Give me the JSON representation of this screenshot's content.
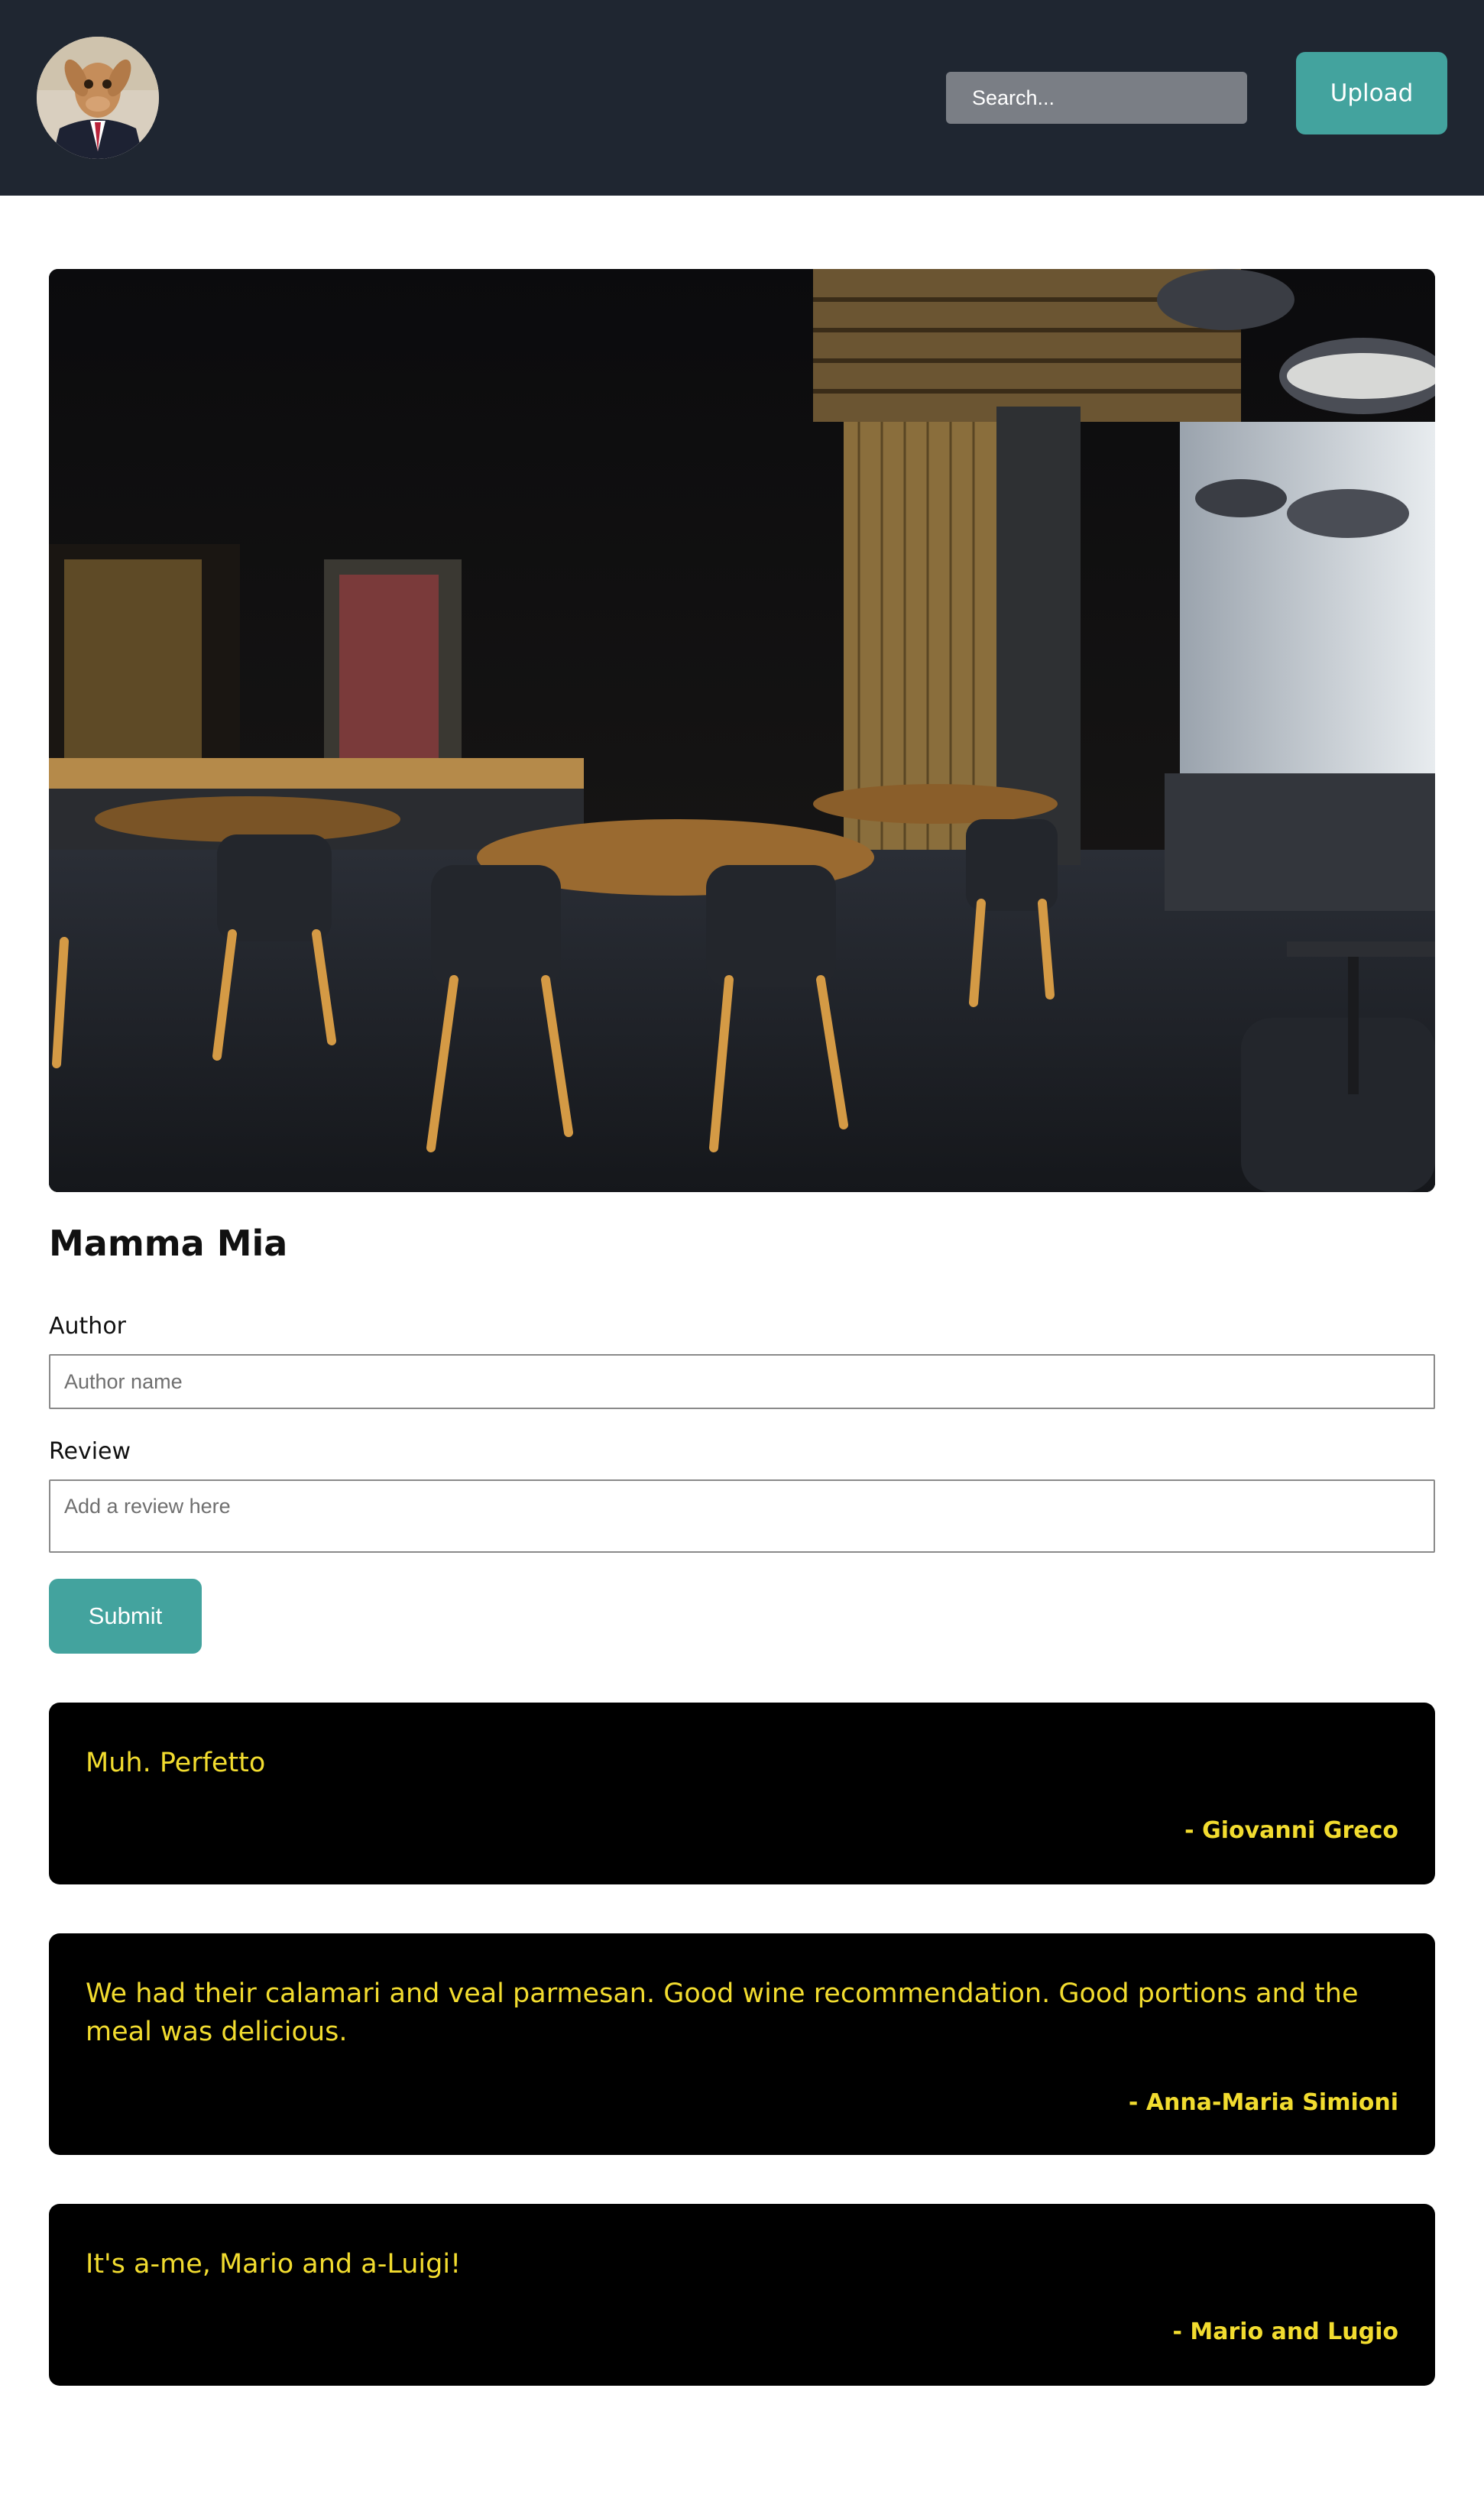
{
  "header": {
    "avatar_alt": "profile avatar",
    "search_placeholder": "Search...",
    "upload_label": "Upload"
  },
  "restaurant": {
    "name": "Mamma Mia"
  },
  "form": {
    "author_label": "Author",
    "author_placeholder": "Author name",
    "review_label": "Review",
    "review_placeholder": "Add a review here",
    "submit_label": "Submit"
  },
  "reviews": [
    {
      "text": "Muh. Perfetto",
      "author": "- Giovanni Greco"
    },
    {
      "text": "We had their calamari and veal parmesan. Good wine recommendation. Good portions and the meal was delicious.",
      "author": "- Anna-Maria Simioni"
    },
    {
      "text": "It's a-me, Mario and a-Luigi!",
      "author": "- Mario and Lugio"
    }
  ],
  "colors": {
    "header_bg": "#1f2631",
    "accent": "#43a39e",
    "card_bg": "#000000",
    "card_text": "#f2dc2f"
  }
}
